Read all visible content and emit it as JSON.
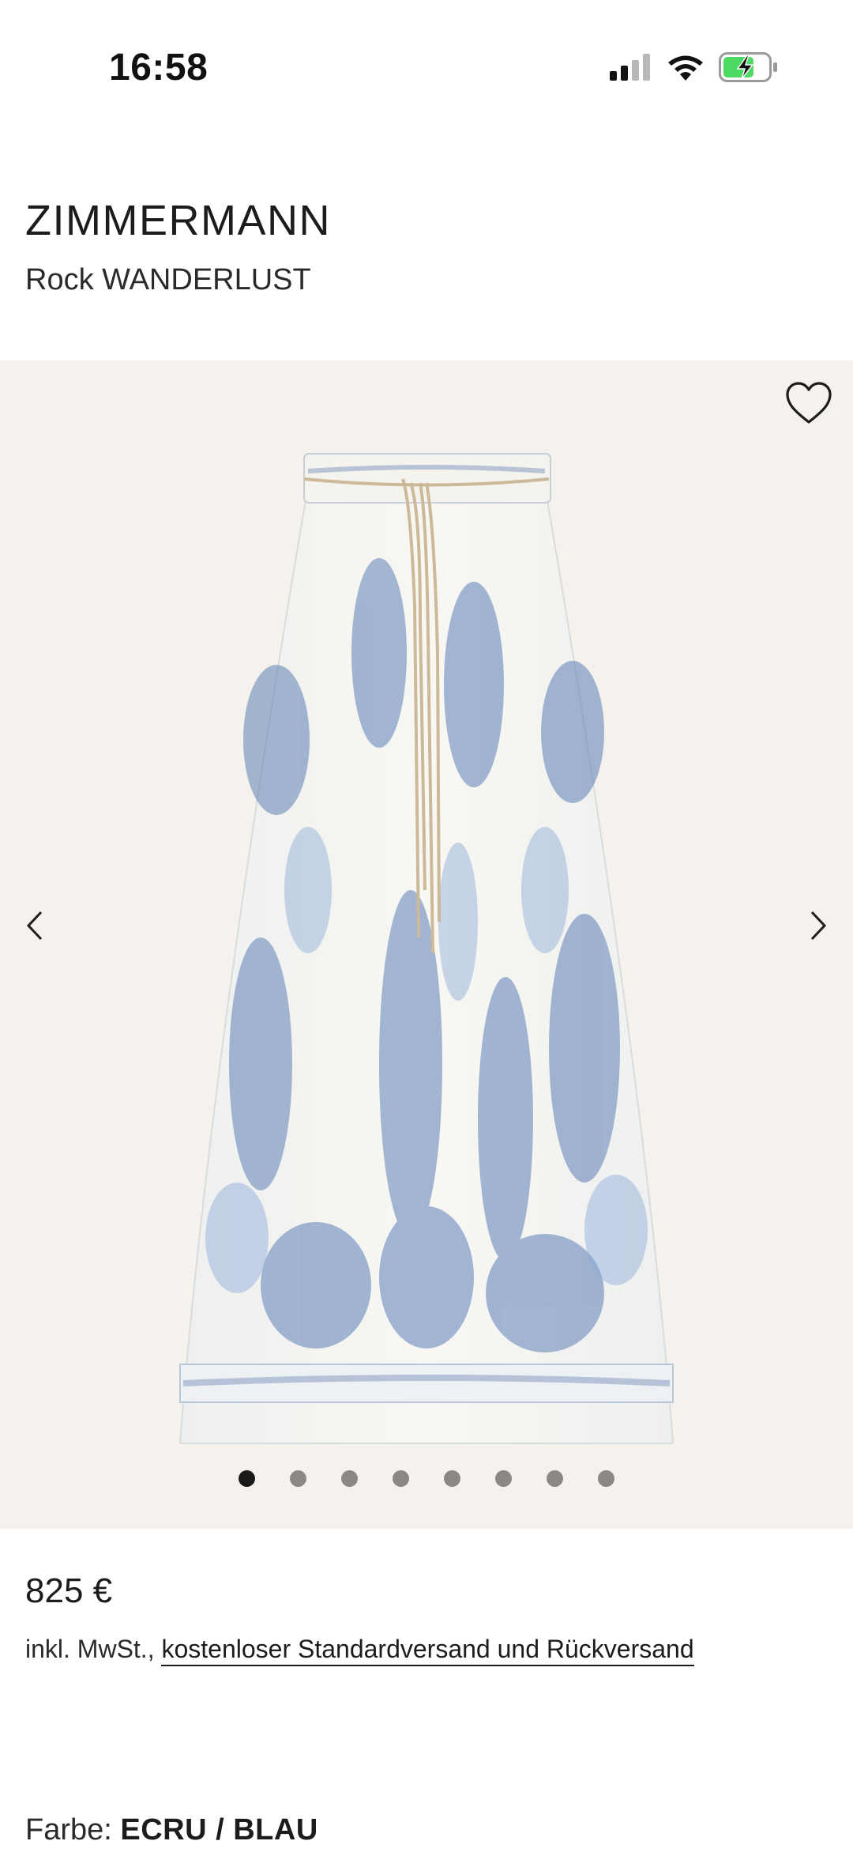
{
  "status_bar": {
    "time": "16:58",
    "icons": [
      "signal-icon",
      "wifi-icon",
      "battery-charging-icon"
    ],
    "battery_color": "#4cd964"
  },
  "product": {
    "brand": "ZIMMERMANN",
    "name": "Rock WANDERLUST",
    "price": "825 €",
    "tax_prefix": "inkl. MwSt.,",
    "shipping_link": "kostenloser Standardversand und Rückversand",
    "color_label": "Farbe:",
    "color_value": "ECRU / BLAU"
  },
  "gallery": {
    "background": "#f5f1ec",
    "image_count": 8,
    "active_index": 0,
    "icons": [
      "heart-icon",
      "chevron-left-icon",
      "chevron-right-icon"
    ]
  }
}
